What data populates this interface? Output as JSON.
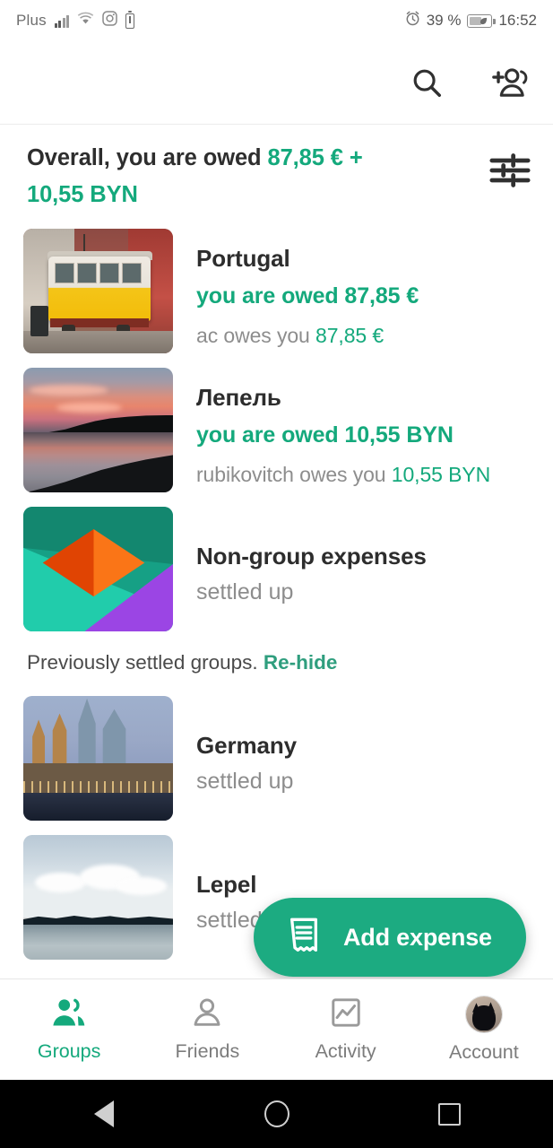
{
  "status_bar": {
    "carrier": "Plus",
    "battery_percent": "39 %",
    "time": "16:52",
    "icons": [
      "signal-icon",
      "wifi-icon",
      "instagram-icon",
      "battery-low-icon",
      "alarm-icon",
      "battery-saver-icon"
    ]
  },
  "app_bar": {
    "search_icon": "search-icon",
    "add_group_icon": "add-group-icon"
  },
  "overall": {
    "prefix": "Overall, you are owed ",
    "amount_eur": "87,85 €",
    "plus": " +",
    "amount_byn": "10,55 BYN",
    "filter_icon": "filter-tune-icon"
  },
  "groups": [
    {
      "name": "Portugal",
      "status": "you are owed 87,85 €",
      "detail_prefix": "ac owes you ",
      "detail_amount": "87,85 €",
      "thumb": "lisbon-tram-photo"
    },
    {
      "name": "Лепель",
      "status": "you are owed 10,55 BYN",
      "detail_prefix": "rubikovitch owes you ",
      "detail_amount": "10,55 BYN",
      "thumb": "sunset-lake-photo"
    },
    {
      "name": "Non-group expenses",
      "status": "settled up",
      "thumb": "splitwise-logo"
    }
  ],
  "settled_section": {
    "label": "Previously settled groups. ",
    "link": "Re-hide",
    "groups": [
      {
        "name": "Germany",
        "status": "settled up",
        "thumb": "cologne-cathedral-photo"
      },
      {
        "name": "Lepel",
        "status": "settled up",
        "thumb": "daytime-lake-photo"
      }
    ]
  },
  "fab": {
    "label": "Add expense",
    "icon": "receipt-icon"
  },
  "bottom_nav": [
    {
      "label": "Groups",
      "icon": "groups-icon",
      "active": true
    },
    {
      "label": "Friends",
      "icon": "person-icon",
      "active": false
    },
    {
      "label": "Activity",
      "icon": "chart-icon",
      "active": false
    },
    {
      "label": "Account",
      "icon": "avatar-icon",
      "active": false
    }
  ],
  "android_nav": [
    "back-button",
    "home-button",
    "recents-button"
  ],
  "colors": {
    "accent_teal": "#14a97c",
    "fab_green": "#1cab81",
    "text_primary": "#2d2d2d",
    "text_secondary": "#8d8d8d"
  }
}
